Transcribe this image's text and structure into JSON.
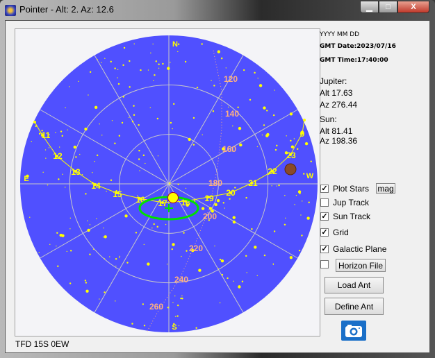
{
  "window": {
    "title": "Pointer - Alt: 2.  Az: 12.6",
    "minimize": "▁",
    "maximize": "□",
    "close": "X"
  },
  "info": {
    "format": "YYYY MM DD",
    "gmt_date": "GMT Date:2023/07/16",
    "gmt_time": "GMT Time:17:40:00",
    "jupiter_label": "Jupiter:",
    "jupiter_alt": "Alt 17.63",
    "jupiter_az": "Az 276.44",
    "sun_label": "Sun:",
    "sun_alt": "Alt 81.41",
    "sun_az": "Az 198.36"
  },
  "options": [
    {
      "label": "Plot Stars",
      "checked": true
    },
    {
      "label": "Jup Track",
      "checked": false
    },
    {
      "label": "Sun Track",
      "checked": true
    },
    {
      "label": "Grid",
      "checked": true
    },
    {
      "label": "Galactic Plane",
      "checked": true
    },
    {
      "label": "",
      "checked": false
    }
  ],
  "buttons": {
    "mag": "mag",
    "horizon": "Horizon File",
    "load": "Load Ant",
    "define": "Define Ant"
  },
  "status": "TFD 15S 0EW",
  "sky": {
    "cardinals": [
      "N",
      "E",
      "W",
      "S"
    ],
    "sun_hours": [
      "11",
      "12",
      "13",
      "14",
      "15",
      "16",
      "17",
      "18",
      "19",
      "20",
      "21",
      "22",
      "23",
      "0"
    ],
    "galactic_labels": [
      "120",
      "140",
      "160",
      "180",
      "200",
      "220",
      "240",
      "260"
    ],
    "colors": {
      "sky": "#5050ff",
      "stars": "#ffff00",
      "grid": "#c8c8c8",
      "galactic": "#ffb080",
      "antenna": "#00e000",
      "jupiter": "#8a4a2a"
    }
  }
}
